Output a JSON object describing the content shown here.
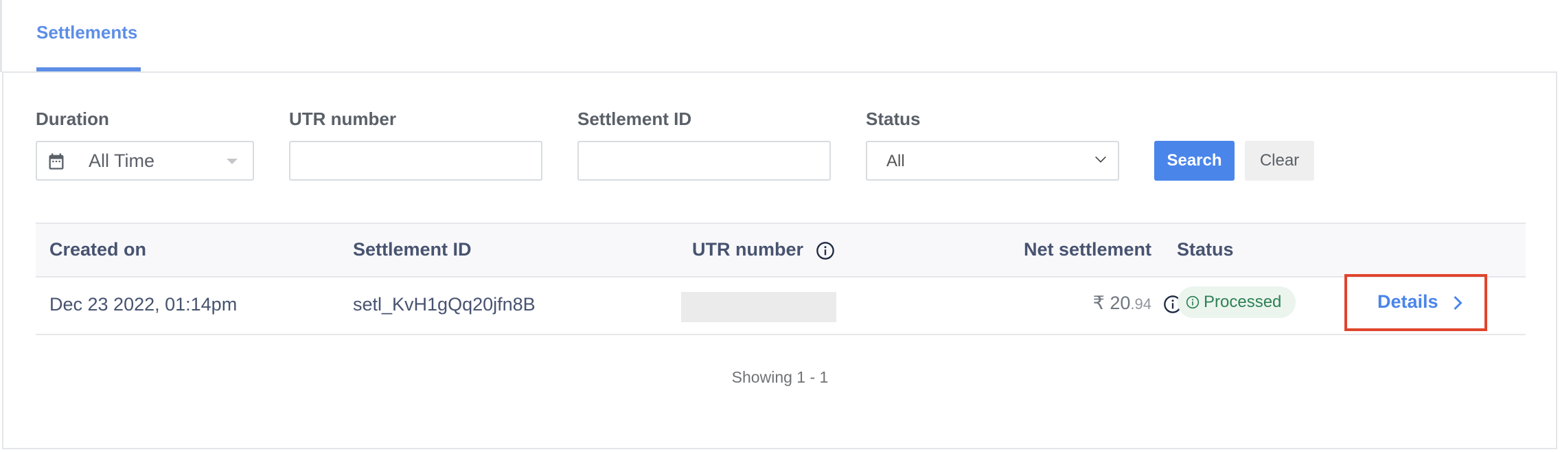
{
  "tabs": [
    {
      "label": "Settlements",
      "active": true
    }
  ],
  "filters": {
    "duration": {
      "label": "Duration",
      "value": "All Time",
      "icon": "calendar-icon"
    },
    "utr": {
      "label": "UTR number",
      "value": "",
      "placeholder": ""
    },
    "settlement_id": {
      "label": "Settlement ID",
      "value": "",
      "placeholder": ""
    },
    "status": {
      "label": "Status",
      "value": "All"
    },
    "search_label": "Search",
    "clear_label": "Clear"
  },
  "table": {
    "columns": [
      "Created on",
      "Settlement ID",
      "UTR number",
      "Net settlement",
      "Status"
    ],
    "rows": [
      {
        "created_on": "Dec 23 2022, 01:14pm",
        "settlement_id": "setl_KvH1gQq20jfn8B",
        "utr_number": "",
        "currency": "₹",
        "amount_whole": "20",
        "amount_decimal": ".94",
        "status": "Processed",
        "action": "Details"
      }
    ]
  },
  "pagination": {
    "text": "Showing 1 - 1"
  },
  "colors": {
    "accent": "#4a85ea",
    "tab": "#5d8ee6",
    "success_text": "#2f8055",
    "success_bg": "#ebf5ee",
    "highlight": "#e0442d"
  }
}
